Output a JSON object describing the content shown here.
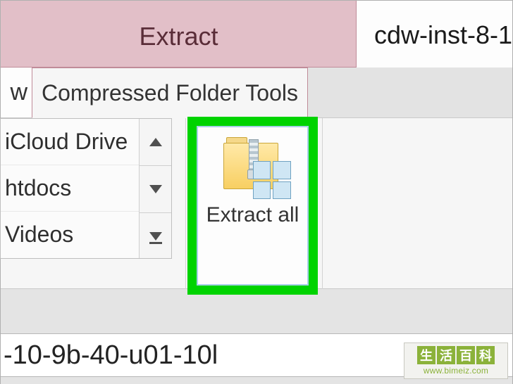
{
  "ribbon": {
    "contextual_title": "Extract",
    "contextual_tab": "Compressed Folder Tools",
    "view_tab_fragment": "w",
    "extract_all_label": "Extract all"
  },
  "title_filename_fragment": "cdw-inst-8-1",
  "extract_to": {
    "items": [
      "iCloud Drive",
      "htdocs",
      "Videos"
    ]
  },
  "address_bar_fragment": "-10-9b-40-u01-10l",
  "watermark": {
    "cn": [
      "生",
      "活",
      "百",
      "科"
    ],
    "url": "www.bimeiz.com"
  }
}
